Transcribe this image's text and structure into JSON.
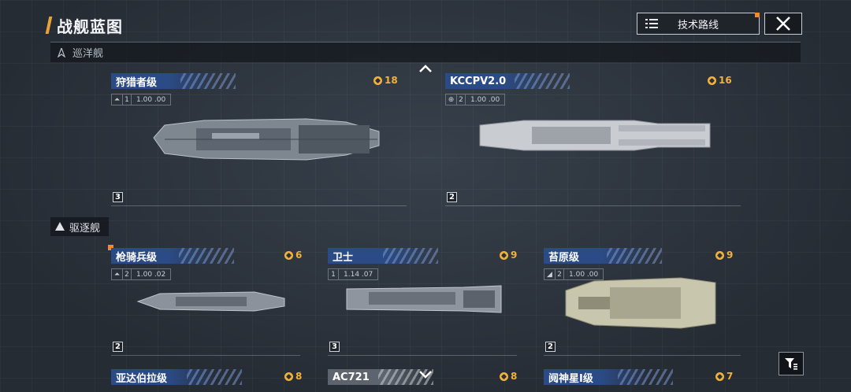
{
  "header": {
    "title": "战舰蓝图",
    "tech_button": "技术路线"
  },
  "sections": {
    "cruiser": "巡洋舰",
    "destroyer": "驱逐舰"
  },
  "colors": {
    "accent": "#e8a23a",
    "name_bar": "#2b4b86",
    "cost": "#f0b23a",
    "selected": "#f08a2c"
  },
  "cards": [
    {
      "name": "狩猎者级",
      "cost": "18",
      "stat_num": "1",
      "stat_val": "1.00 .00",
      "level": "3"
    },
    {
      "name": "KCCPV2.0",
      "cost": "16",
      "stat_num": "2",
      "stat_val": "1.00 .00",
      "level": "2"
    },
    {
      "name": "枪骑兵级",
      "cost": "6",
      "stat_num": "2",
      "stat_val": "1.00 .02",
      "level": "2"
    },
    {
      "name": "卫士",
      "cost": "9",
      "stat_num": "1",
      "stat_val": "1.14 .07",
      "level": "3"
    },
    {
      "name": "苔原级",
      "cost": "9",
      "stat_num": "2",
      "stat_val": "1.00 .00",
      "level": "2"
    },
    {
      "name": "亚达伯拉级",
      "cost": "8"
    },
    {
      "name": "AC721",
      "cost": "8"
    },
    {
      "name": "阋神星Ⅰ级",
      "cost": "7"
    }
  ]
}
